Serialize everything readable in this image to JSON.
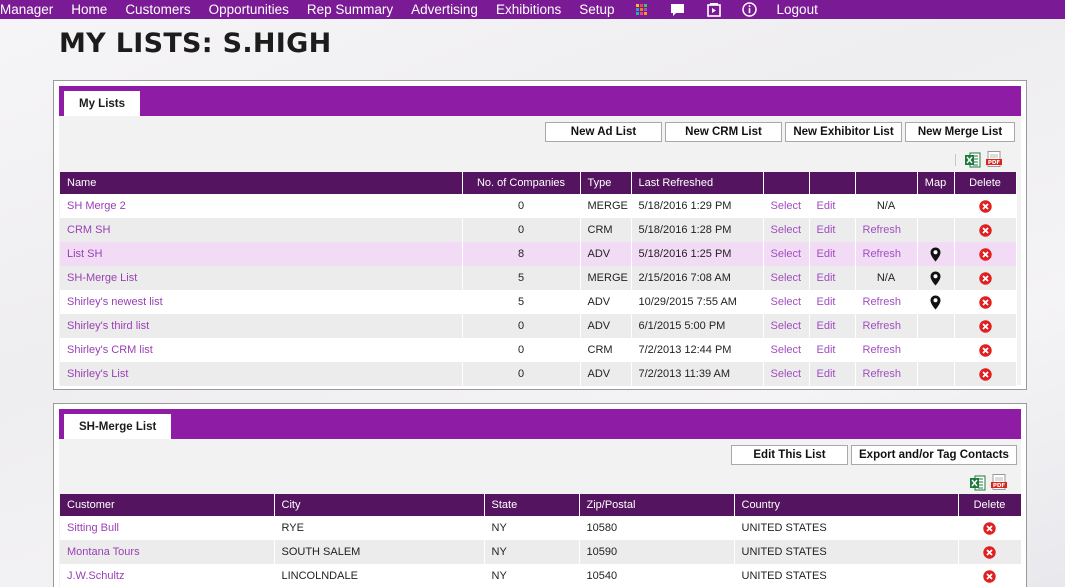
{
  "nav": {
    "items": [
      "Manager",
      "Home",
      "Customers",
      "Opportunities",
      "Rep Summary",
      "Advertising",
      "Exhibitions",
      "Setup"
    ],
    "logout": "Logout",
    "icons": [
      "apps-grid-icon",
      "chat-icon",
      "video-icon",
      "info-icon"
    ]
  },
  "page_title": "MY LISTS: S.HIGH",
  "colors": {
    "brand": "#8e1ca5",
    "header": "#55145f",
    "link": "#9a3fb5",
    "delete": "#e02020",
    "highlight_row": "#f2dcf5"
  },
  "lists_panel": {
    "tab": "My Lists",
    "buttons": {
      "new_ad": "New Ad List",
      "new_crm": "New CRM List",
      "new_exhibitor": "New Exhibitor List",
      "new_merge": "New Merge List"
    },
    "columns": {
      "name": "Name",
      "companies": "No. of Companies",
      "type": "Type",
      "refreshed": "Last Refreshed",
      "map": "Map",
      "delete": "Delete"
    },
    "rows": [
      {
        "name": "SH Merge 2",
        "companies": "0",
        "type": "MERGE",
        "refreshed": "5/18/2016 1:29 PM",
        "select": "Select",
        "edit": "Edit",
        "refresh": "N/A",
        "map": false
      },
      {
        "name": "CRM SH",
        "companies": "0",
        "type": "CRM",
        "refreshed": "5/18/2016 1:28 PM",
        "select": "Select",
        "edit": "Edit",
        "refresh": "Refresh",
        "map": false
      },
      {
        "name": "List SH",
        "companies": "8",
        "type": "ADV",
        "refreshed": "5/18/2016 1:25 PM",
        "select": "Select",
        "edit": "Edit",
        "refresh": "Refresh",
        "map": true
      },
      {
        "name": "SH-Merge List",
        "companies": "5",
        "type": "MERGE",
        "refreshed": "2/15/2016 7:08 AM",
        "select": "Select",
        "edit": "Edit",
        "refresh": "N/A",
        "map": true
      },
      {
        "name": "Shirley's newest list",
        "companies": "5",
        "type": "ADV",
        "refreshed": "10/29/2015 7:55 AM",
        "select": "Select",
        "edit": "Edit",
        "refresh": "Refresh",
        "map": true
      },
      {
        "name": "Shirley's third list",
        "companies": "0",
        "type": "ADV",
        "refreshed": "6/1/2015 5:00 PM",
        "select": "Select",
        "edit": "Edit",
        "refresh": "Refresh",
        "map": false
      },
      {
        "name": "Shirley's CRM list",
        "companies": "0",
        "type": "CRM",
        "refreshed": "7/2/2013 12:44 PM",
        "select": "Select",
        "edit": "Edit",
        "refresh": "Refresh",
        "map": false
      },
      {
        "name": "Shirley's List",
        "companies": "0",
        "type": "ADV",
        "refreshed": "7/2/2013 11:39 AM",
        "select": "Select",
        "edit": "Edit",
        "refresh": "Refresh",
        "map": false
      }
    ]
  },
  "detail_panel": {
    "tab": "SH-Merge List",
    "buttons": {
      "edit_list": "Edit This List",
      "export": "Export and/or Tag Contacts"
    },
    "columns": {
      "customer": "Customer",
      "city": "City",
      "state": "State",
      "zip": "Zip/Postal",
      "country": "Country",
      "delete": "Delete"
    },
    "rows": [
      {
        "customer": "Sitting Bull",
        "city": "RYE",
        "state": "NY",
        "zip": "10580",
        "country": "UNITED STATES"
      },
      {
        "customer": "Montana Tours",
        "city": "SOUTH SALEM",
        "state": "NY",
        "zip": "10590",
        "country": "UNITED STATES"
      },
      {
        "customer": "J.W.Schultz",
        "city": "LINCOLNDALE",
        "state": "NY",
        "zip": "10540",
        "country": "UNITED STATES"
      }
    ]
  }
}
